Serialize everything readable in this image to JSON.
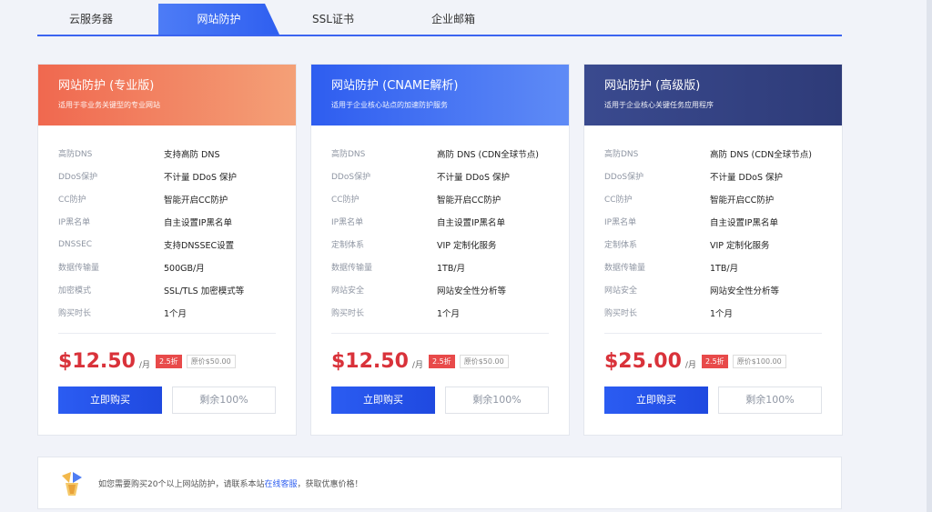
{
  "tabs": [
    {
      "label": "云服务器"
    },
    {
      "label": "网站防护"
    },
    {
      "label": "SSL证书"
    },
    {
      "label": "企业邮箱"
    }
  ],
  "active_tab": "网站防护",
  "cards": [
    {
      "title": "网站防护 (专业版)",
      "subtitle": "适用于非业务关键型的专业网站",
      "header_color": "#f0775e",
      "specs": [
        {
          "label": "高防DNS",
          "value": "支持高防 DNS"
        },
        {
          "label": "DDoS保护",
          "value": "不计量 DDoS 保护"
        },
        {
          "label": "CC防护",
          "value": "智能开启CC防护"
        },
        {
          "label": "IP黑名单",
          "value": "自主设置IP黑名单"
        },
        {
          "label": "DNSSEC",
          "value": "支持DNSSEC设置"
        },
        {
          "label": "数据传输量",
          "value": "500GB/月"
        },
        {
          "label": "加密模式",
          "value": "SSL/TLS 加密模式等"
        },
        {
          "label": "购买时长",
          "value": "1个月"
        }
      ],
      "price": "$12.50",
      "per": "/月",
      "discount": "2.5折",
      "original": "原价$50.00",
      "buy_label": "立即购买",
      "stock_label": "剩余100%"
    },
    {
      "title": "网站防护 (CNAME解析)",
      "subtitle": "适用于企业核心站点的加速防护服务",
      "header_color": "#3e6cf2",
      "specs": [
        {
          "label": "高防DNS",
          "value": "高防 DNS (CDN全球节点)"
        },
        {
          "label": "DDoS保护",
          "value": "不计量 DDoS 保护"
        },
        {
          "label": "CC防护",
          "value": "智能开启CC防护"
        },
        {
          "label": "IP黑名单",
          "value": "自主设置IP黑名单"
        },
        {
          "label": "定制体系",
          "value": "VIP 定制化服务"
        },
        {
          "label": "数据传输量",
          "value": "1TB/月"
        },
        {
          "label": "网站安全",
          "value": "网站安全性分析等"
        },
        {
          "label": "购买时长",
          "value": "1个月"
        }
      ],
      "price": "$12.50",
      "per": "/月",
      "discount": "2.5折",
      "original": "原价$50.00",
      "buy_label": "立即购买",
      "stock_label": "剩余100%"
    },
    {
      "title": "网站防护 (高级版)",
      "subtitle": "适用于企业核心关键任务应用程序",
      "header_color": "#3d4c8a",
      "specs": [
        {
          "label": "高防DNS",
          "value": "高防 DNS (CDN全球节点)"
        },
        {
          "label": "DDoS保护",
          "value": "不计量 DDoS 保护"
        },
        {
          "label": "CC防护",
          "value": "智能开启CC防护"
        },
        {
          "label": "IP黑名单",
          "value": "自主设置IP黑名单"
        },
        {
          "label": "定制体系",
          "value": "VIP 定制化服务"
        },
        {
          "label": "数据传输量",
          "value": "1TB/月"
        },
        {
          "label": "网站安全",
          "value": "网站安全性分析等"
        },
        {
          "label": "购买时长",
          "value": "1个月"
        }
      ],
      "price": "$25.00",
      "per": "/月",
      "discount": "2.5折",
      "original": "原价$100.00",
      "buy_label": "立即购买",
      "stock_label": "剩余100%"
    }
  ],
  "notice": {
    "text_before": "如您需要购买20个以上网站防护，请联系本站",
    "link": "在线客服",
    "text_after": "，获取优惠价格！",
    "icon": "gift-icon"
  }
}
